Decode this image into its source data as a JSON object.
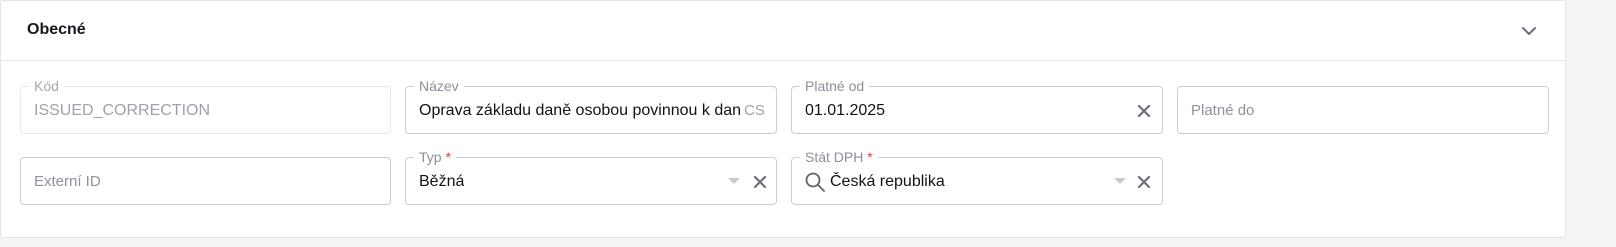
{
  "section": {
    "title": "Obecné",
    "collapse_icon": "chevron-down-icon"
  },
  "fields": {
    "kod": {
      "label": "Kód",
      "value": "ISSUED_CORRECTION"
    },
    "nazev": {
      "label": "Název",
      "value": "Oprava základu daně osobou povinnou k dani",
      "suffix": "CS"
    },
    "platne_od": {
      "label": "Platné od",
      "value": "01.01.2025"
    },
    "platne_do": {
      "placeholder": "Platné do"
    },
    "externi_id": {
      "placeholder": "Externí ID"
    },
    "typ": {
      "label": "Typ",
      "required_mark": "*",
      "value": "Běžná"
    },
    "stat_dph": {
      "label": "Stát DPH",
      "required_mark": "*",
      "value": "Česká republika"
    }
  },
  "colors": {
    "border": "#c9cdd4",
    "required": "#e53935",
    "text": "#111317",
    "muted": "#8a8f99"
  }
}
